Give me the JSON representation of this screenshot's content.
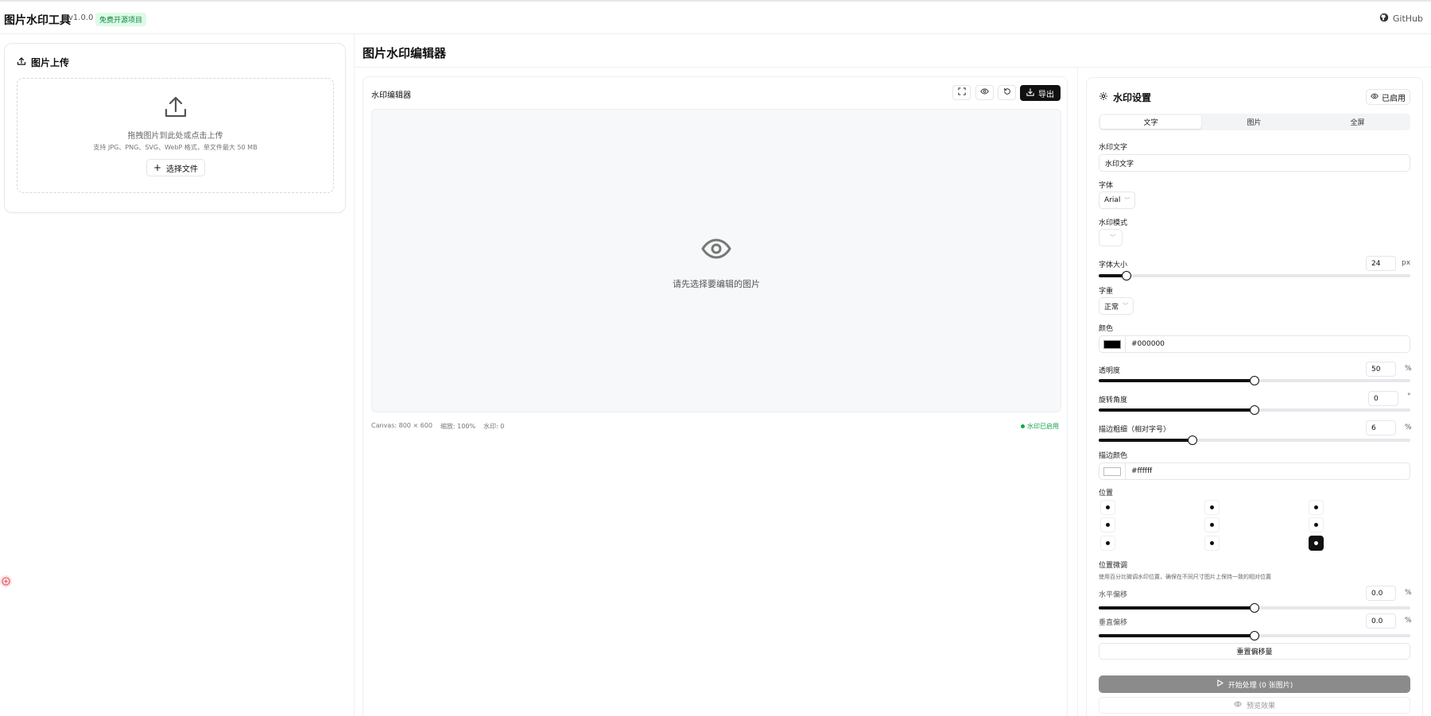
{
  "header": {
    "app_title": "图片水印工具",
    "version": "v1.0.0",
    "badge": "免费开源项目",
    "github_label": "GitHub"
  },
  "upload": {
    "title": "图片上传",
    "drop_text": "拖拽图片到此处或点击上传",
    "drop_sub": "支持 JPG、PNG、SVG、WebP 格式，单文件最大 50 MB",
    "choose_label": "选择文件"
  },
  "main": {
    "title": "图片水印编辑器"
  },
  "editor": {
    "label": "水印编辑器",
    "export_label": "导出",
    "empty_text": "请先选择要编辑的图片",
    "canvas_size": "Canvas: 800 × 600",
    "zoom": "缩放: 100%",
    "wm_count": "水印: 0",
    "wm_status": "水印已启用"
  },
  "settings": {
    "title": "水印设置",
    "enabled_label": "已启用",
    "tabs": [
      "文字",
      "图片",
      "全屏"
    ],
    "active_tab": 0,
    "text_label": "水印文字",
    "text_value": "水印文字",
    "font_label": "字体",
    "font_value": "Arial",
    "mode_label": "水印模式",
    "mode_value": "",
    "size_label": "字体大小",
    "size_value": "24",
    "size_unit": "px",
    "size_fraction": 0.09,
    "weight_label": "字重",
    "weight_value": "正常",
    "color_label": "颜色",
    "color_value": "#000000",
    "opacity_label": "透明度",
    "opacity_value": "50",
    "opacity_unit": "%",
    "opacity_fraction": 0.5,
    "rotation_label": "旋转角度",
    "rotation_value": "0",
    "rotation_unit": "°",
    "rotation_fraction": 0.5,
    "stroke_label": "描边粗细（相对字号）",
    "stroke_value": "6",
    "stroke_unit": "%",
    "stroke_fraction": 0.3,
    "stroke_color_label": "描边颜色",
    "stroke_color_value": "#ffffff",
    "position_label": "位置",
    "position_selected": 8,
    "offset_label": "位置微调",
    "offset_hint": "使用百分比微调水印位置，确保在不同尺寸图片上保持一致的相对位置",
    "h_offset_label": "水平偏移",
    "h_offset_value": "0.0",
    "h_offset_unit": "%",
    "h_offset_fraction": 0.5,
    "v_offset_label": "垂直偏移",
    "v_offset_value": "0.0",
    "v_offset_unit": "%",
    "v_offset_fraction": 0.5,
    "reset_label": "重置偏移量",
    "start_label": "开始处理 (0 张图片)",
    "preview_label": "预览效果"
  },
  "colors": {
    "primary": "#111111",
    "badge_bg": "#dcfce7",
    "badge_text": "#15803d",
    "status_green": "#16a34a",
    "start_disabled": "#8b8b8b"
  }
}
